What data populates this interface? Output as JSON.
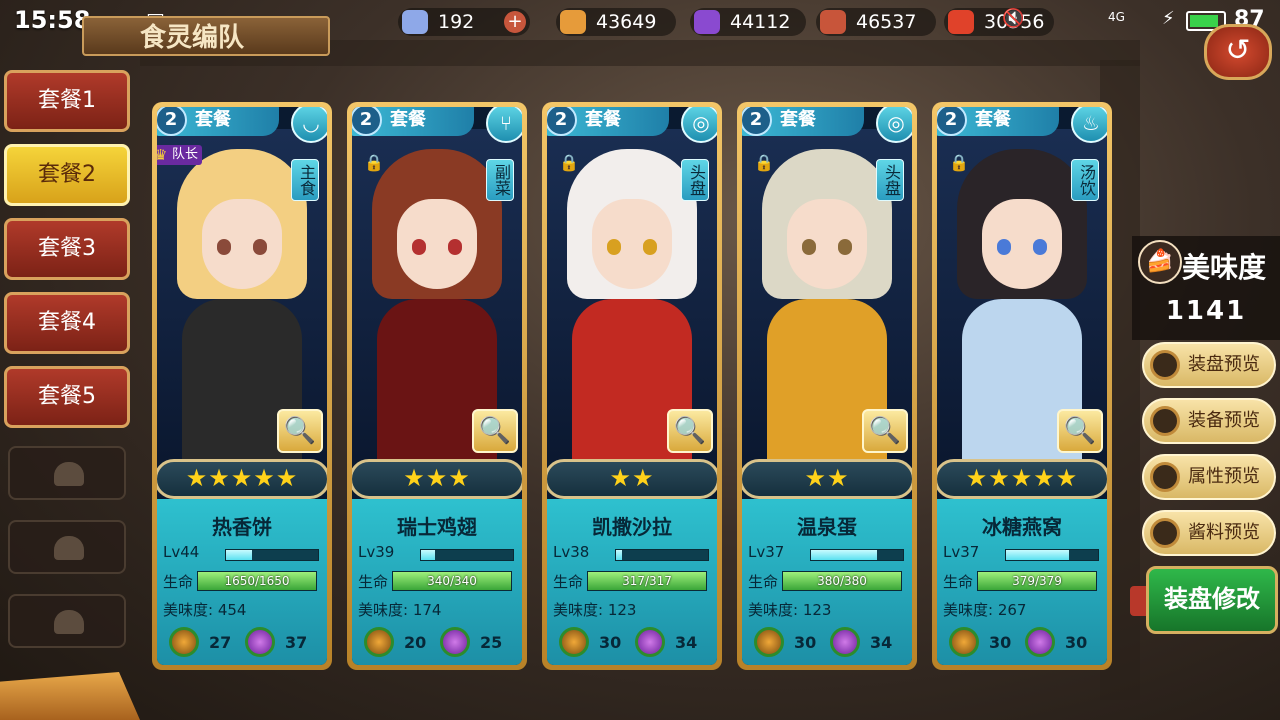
{
  "status_bar": {
    "time": "15:58",
    "battery": "87",
    "network": "4G"
  },
  "title": "食灵编队",
  "resources": [
    {
      "name": "crystal",
      "value": "192",
      "color": "#8ea8e8"
    },
    {
      "name": "potion",
      "value": "43649",
      "color": "#e69b3a"
    },
    {
      "name": "gem",
      "value": "44112",
      "color": "#8a4ad0"
    },
    {
      "name": "meat",
      "value": "46537",
      "color": "#c8553a"
    },
    {
      "name": "bowl",
      "value": "30356",
      "color": "#e0422a"
    }
  ],
  "tabs": [
    "套餐1",
    "套餐2",
    "套餐3",
    "套餐4",
    "套餐5"
  ],
  "active_tab": 1,
  "cards": [
    {
      "slot": "2",
      "set": "套餐",
      "type": "主食",
      "type_icon": "bowl-icon",
      "leader": "队长",
      "stars": "★★★★★",
      "name": "热香饼",
      "level": "Lv44",
      "level_frac": 0.28,
      "hp_label": "生命",
      "hp": "1650/1650",
      "hp_frac": 1.0,
      "flavor_label": "美味度:",
      "flavor": "454",
      "res1": "27",
      "res2": "37",
      "hair": "#f3cf82",
      "outfit": "#2a2a2a",
      "eye": "#8a4a3a"
    },
    {
      "slot": "2",
      "set": "套餐",
      "type": "副菜",
      "type_icon": "fork-icon",
      "leader": "",
      "stars": "★★★",
      "name": "瑞士鸡翅",
      "level": "Lv39",
      "level_frac": 0.15,
      "hp_label": "生命",
      "hp": "340/340",
      "hp_frac": 1.0,
      "flavor_label": "美味度:",
      "flavor": "174",
      "res1": "20",
      "res2": "25",
      "hair": "#8a3a24",
      "outfit": "#6a1414",
      "eye": "#b43030"
    },
    {
      "slot": "2",
      "set": "套餐",
      "type": "头盘",
      "type_icon": "plate-icon",
      "leader": "",
      "stars": "★★",
      "name": "凯撒沙拉",
      "level": "Lv38",
      "level_frac": 0.06,
      "hp_label": "生命",
      "hp": "317/317",
      "hp_frac": 1.0,
      "flavor_label": "美味度:",
      "flavor": "123",
      "res1": "30",
      "res2": "34",
      "hair": "#f2eeec",
      "outfit": "#c22a22",
      "eye": "#d8a020"
    },
    {
      "slot": "2",
      "set": "套餐",
      "type": "头盘",
      "type_icon": "plate-icon",
      "leader": "",
      "stars": "★★",
      "name": "温泉蛋",
      "level": "Lv37",
      "level_frac": 0.72,
      "hp_label": "生命",
      "hp": "380/380",
      "hp_frac": 1.0,
      "flavor_label": "美味度:",
      "flavor": "123",
      "res1": "30",
      "res2": "34",
      "hair": "#dcd8c6",
      "outfit": "#e0a028",
      "eye": "#8a6a3a"
    },
    {
      "slot": "2",
      "set": "套餐",
      "type": "汤饮",
      "type_icon": "soup-icon",
      "leader": "",
      "stars": "★★★★★",
      "name": "冰糖燕窝",
      "level": "Lv37",
      "level_frac": 0.68,
      "hp_label": "生命",
      "hp": "379/379",
      "hp_frac": 1.0,
      "flavor_label": "美味度:",
      "flavor": "267",
      "res1": "30",
      "res2": "30",
      "hair": "#2a2428",
      "outfit": "#bcd6ee",
      "eye": "#4a7ad8"
    }
  ],
  "flavor_panel": {
    "title": "美味度",
    "value": "1141"
  },
  "side_buttons": [
    "装盘预览",
    "装备预览",
    "属性预览",
    "酱料预览"
  ],
  "modify_button": "装盘修改"
}
